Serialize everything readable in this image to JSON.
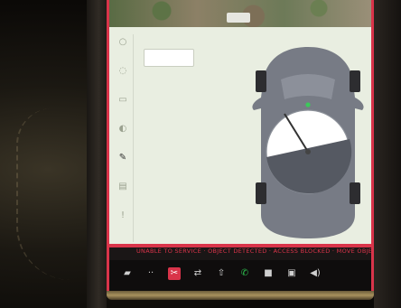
{
  "screen": {
    "map_chip": "",
    "setting_title": "",
    "setting_box": "",
    "warning_text": "UNABLE TO SERVICE · OBJECT DETECTED · ACCESS BLOCKED · MOVE OBJECT AWAY TO CONTINUE"
  },
  "side_menu": [
    {
      "name": "controls-icon",
      "glyph": "○"
    },
    {
      "name": "lights-icon",
      "glyph": "◌"
    },
    {
      "name": "driving-icon",
      "glyph": "▭"
    },
    {
      "name": "autopilot-icon",
      "glyph": "◐"
    },
    {
      "name": "service-icon",
      "glyph": "✎",
      "active": true
    },
    {
      "name": "schedule-icon",
      "glyph": "▤"
    },
    {
      "name": "safety-icon",
      "glyph": "!"
    }
  ],
  "bottom_bar": [
    {
      "name": "car-icon",
      "glyph": "▰"
    },
    {
      "name": "temperature-icon",
      "glyph": "··"
    },
    {
      "name": "service-wrench-icon",
      "glyph": "✂",
      "style": "wrench"
    },
    {
      "name": "media-icon",
      "glyph": "⇄"
    },
    {
      "name": "navigation-icon",
      "glyph": "⇧"
    },
    {
      "name": "phone-icon",
      "glyph": "✆",
      "style": "phone"
    },
    {
      "name": "app-icon",
      "glyph": "■"
    },
    {
      "name": "camera-icon",
      "glyph": "▣"
    },
    {
      "name": "volume-icon",
      "glyph": "◀)"
    }
  ],
  "colors": {
    "accent_red": "#d9344a",
    "panel_bg": "#e9eee1",
    "car_body": "#777b85",
    "dial_fill": "#ffffff"
  }
}
